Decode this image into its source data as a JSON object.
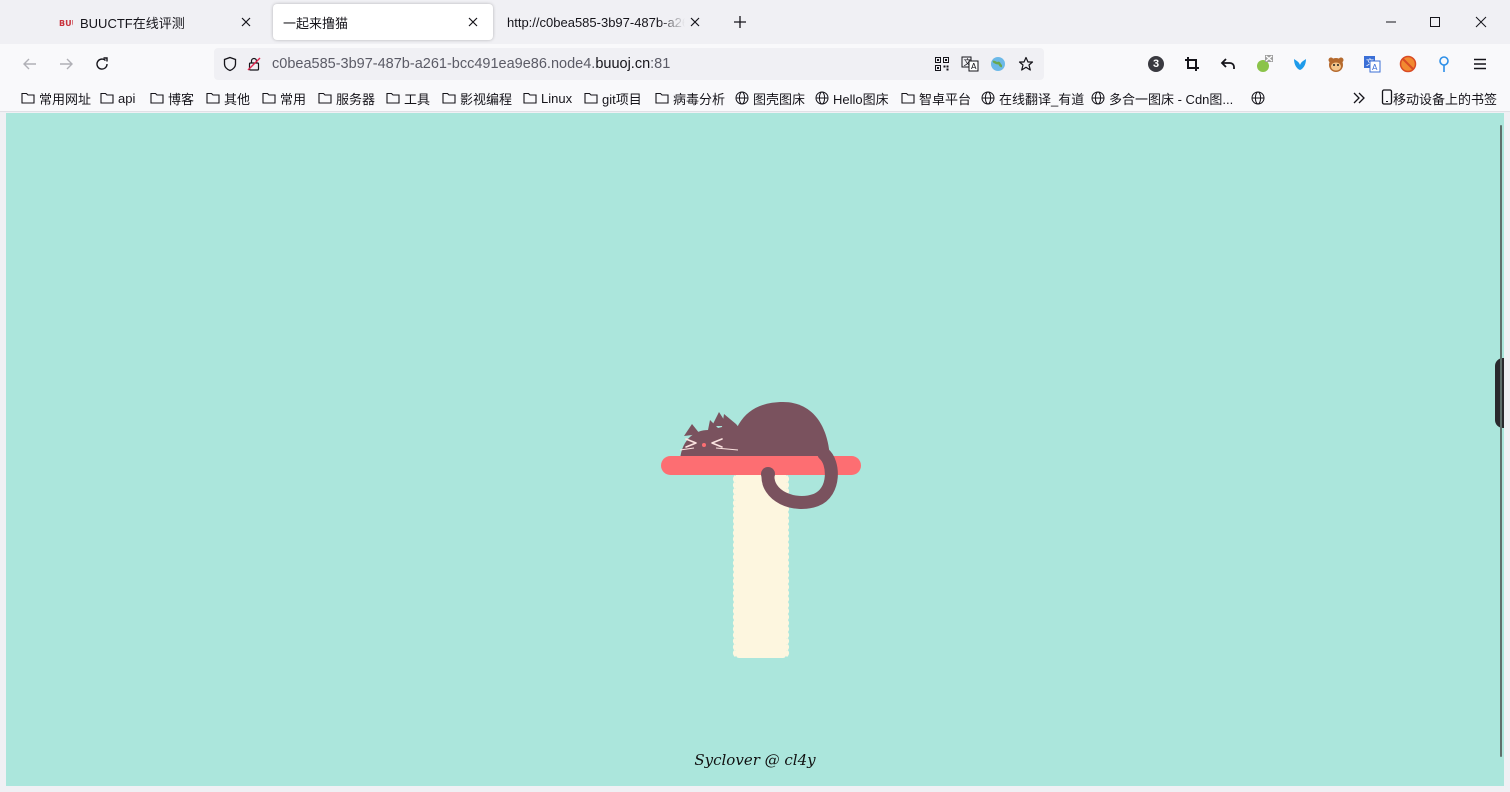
{
  "tabs": [
    {
      "title": "BUUCTF在线评测",
      "active": false,
      "favicon": "buuctf-logo-icon"
    },
    {
      "title": "一起来撸猫",
      "active": true
    },
    {
      "title": "http://c0bea585-3b97-487b-a26",
      "active": false
    }
  ],
  "navbar": {
    "url_prefix": "c0bea585-3b97-487b-a261-bcc491ea9e86.node4.",
    "url_domain": "buuoj.cn",
    "url_suffix": ":81",
    "extension_badge": "3"
  },
  "bookmarks": [
    {
      "label": "常用网址",
      "icon": "folder-icon"
    },
    {
      "label": "api",
      "icon": "folder-icon"
    },
    {
      "label": "博客",
      "icon": "folder-icon"
    },
    {
      "label": "其他",
      "icon": "folder-icon"
    },
    {
      "label": "常用",
      "icon": "folder-icon"
    },
    {
      "label": "服务器",
      "icon": "folder-icon"
    },
    {
      "label": "工具",
      "icon": "folder-icon"
    },
    {
      "label": "影视编程",
      "icon": "folder-icon"
    },
    {
      "label": "Linux",
      "icon": "folder-icon"
    },
    {
      "label": "git项目",
      "icon": "folder-icon"
    },
    {
      "label": "病毒分析",
      "icon": "folder-icon"
    },
    {
      "label": "图壳图床",
      "icon": "globe-icon"
    },
    {
      "label": "Hello图床",
      "icon": "globe-icon"
    },
    {
      "label": "智卓平台",
      "icon": "folder-icon"
    },
    {
      "label": "在线翻译_有道",
      "icon": "globe-icon"
    },
    {
      "label": "多合一图床 - Cdn图...",
      "icon": "globe-icon"
    },
    {
      "label": "",
      "icon": "globe-icon"
    }
  ],
  "mobile_bookmarks": "移动设备上的书签",
  "page": {
    "signature": "Syclover @ cl4y",
    "background": "#abe6dc",
    "cat_color": "#7a525e",
    "perch_color": "#fd6e72",
    "post_color": "#fdf6df"
  }
}
